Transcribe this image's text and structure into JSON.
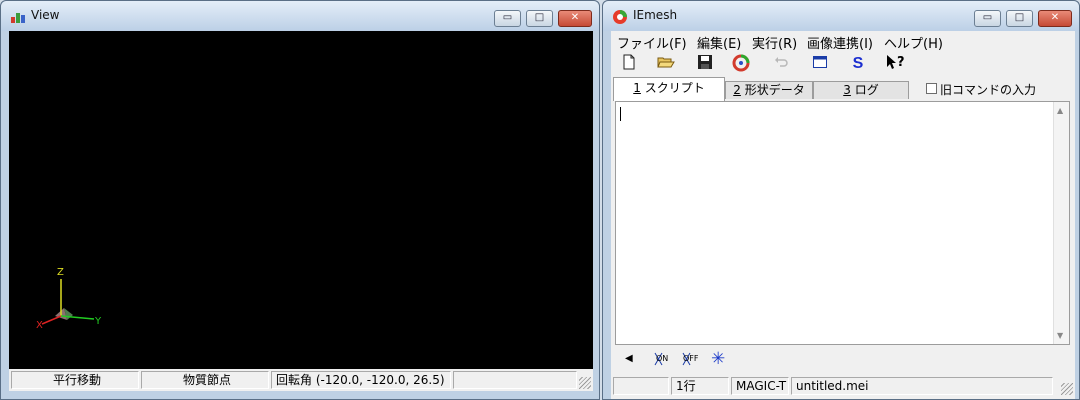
{
  "view_window": {
    "title": "View",
    "controls": {
      "minimize": "▭",
      "maximize": "□",
      "close": "✕"
    },
    "axes": {
      "x": "X",
      "y": "Y",
      "z": "Z"
    },
    "status": {
      "pan": "平行移動",
      "material_node": "物質節点",
      "rotation": "回転角 (-120.0, -120.0, 26.5)"
    }
  },
  "iemesh_window": {
    "title": "IEmesh",
    "controls": {
      "minimize": "▭",
      "maximize": "□",
      "close": "✕"
    },
    "menu": {
      "file": "ファイル(F)",
      "edit": "編集(E)",
      "run": "実行(R)",
      "image": "画像連携(I)",
      "help": "ヘルプ(H)"
    },
    "toolbar_icons": [
      "new-file-icon",
      "open-folder-icon",
      "save-icon",
      "run-icon",
      "undo-icon",
      "window-icon",
      "s-icon",
      "help-pointer-icon"
    ],
    "toolbar_glyphs": {
      "s": "S",
      "help": "?"
    },
    "tabs": [
      {
        "key": "1",
        "label": "スクリプト"
      },
      {
        "key": "2",
        "label": "形状データ"
      },
      {
        "key": "3",
        "label": "ログ"
      }
    ],
    "legacy_command_label": "旧コマンドの入力",
    "legacy_command_checked": false,
    "editor_text": "",
    "bottom_icons": [
      "left-arrow-icon",
      "on-marker-icon",
      "off-marker-icon",
      "asterisk-icon"
    ],
    "bottom_glyphs": {
      "on": "ON",
      "off": "OFF",
      "star": "✳"
    },
    "status": {
      "line": "1行",
      "mode": "MAGIC-T",
      "file": "untitled.mei"
    }
  }
}
